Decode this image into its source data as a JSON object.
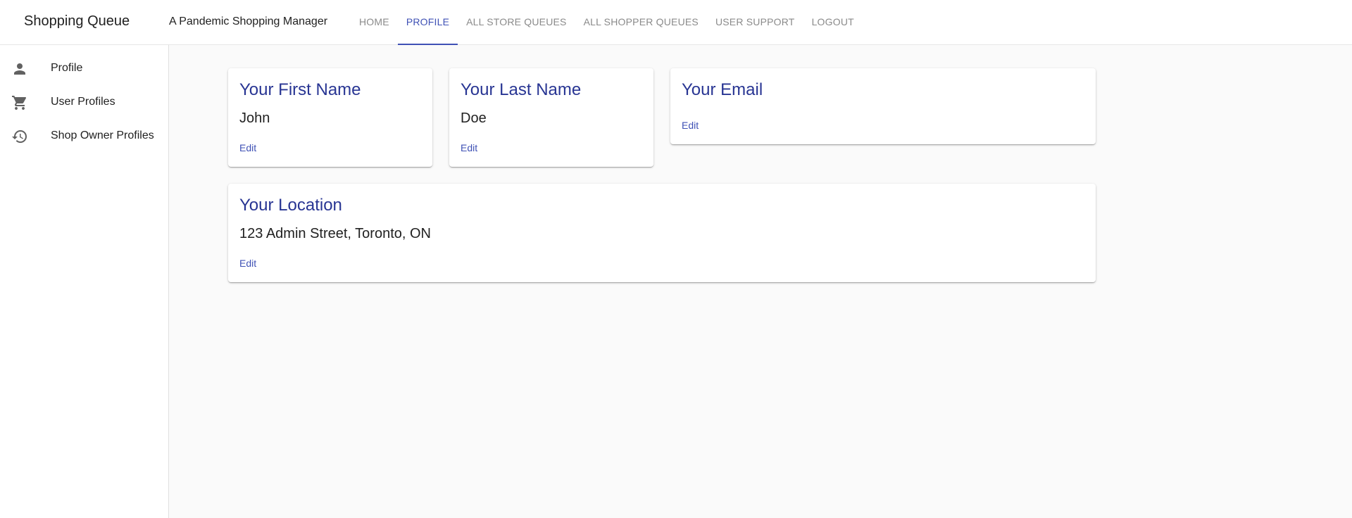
{
  "header": {
    "app_title": "Shopping Queue",
    "subtitle": "A Pandemic Shopping Manager",
    "nav": [
      {
        "label": "HOME",
        "active": false
      },
      {
        "label": "PROFILE",
        "active": true
      },
      {
        "label": "ALL STORE QUEUES",
        "active": false
      },
      {
        "label": "ALL SHOPPER QUEUES",
        "active": false
      },
      {
        "label": "USER SUPPORT",
        "active": false
      },
      {
        "label": "LOGOUT",
        "active": false
      }
    ]
  },
  "sidebar": {
    "items": [
      {
        "label": "Profile",
        "icon": "person-icon"
      },
      {
        "label": "User Profiles",
        "icon": "shopping-cart-icon"
      },
      {
        "label": "Shop Owner Profiles",
        "icon": "history-icon"
      }
    ]
  },
  "cards": {
    "first_name": {
      "title": "Your First Name",
      "value": "John",
      "action": "Edit"
    },
    "last_name": {
      "title": "Your Last Name",
      "value": "Doe",
      "action": "Edit"
    },
    "email": {
      "title": "Your Email",
      "value": "",
      "action": "Edit"
    },
    "location": {
      "title": "Your Location",
      "value": "123 Admin Street, Toronto, ON",
      "action": "Edit"
    }
  },
  "colors": {
    "accent": "#3f51b5",
    "card_title": "#283593",
    "nav_inactive": "#8a8a8a",
    "icon": "#616161",
    "background": "#fafafa"
  }
}
